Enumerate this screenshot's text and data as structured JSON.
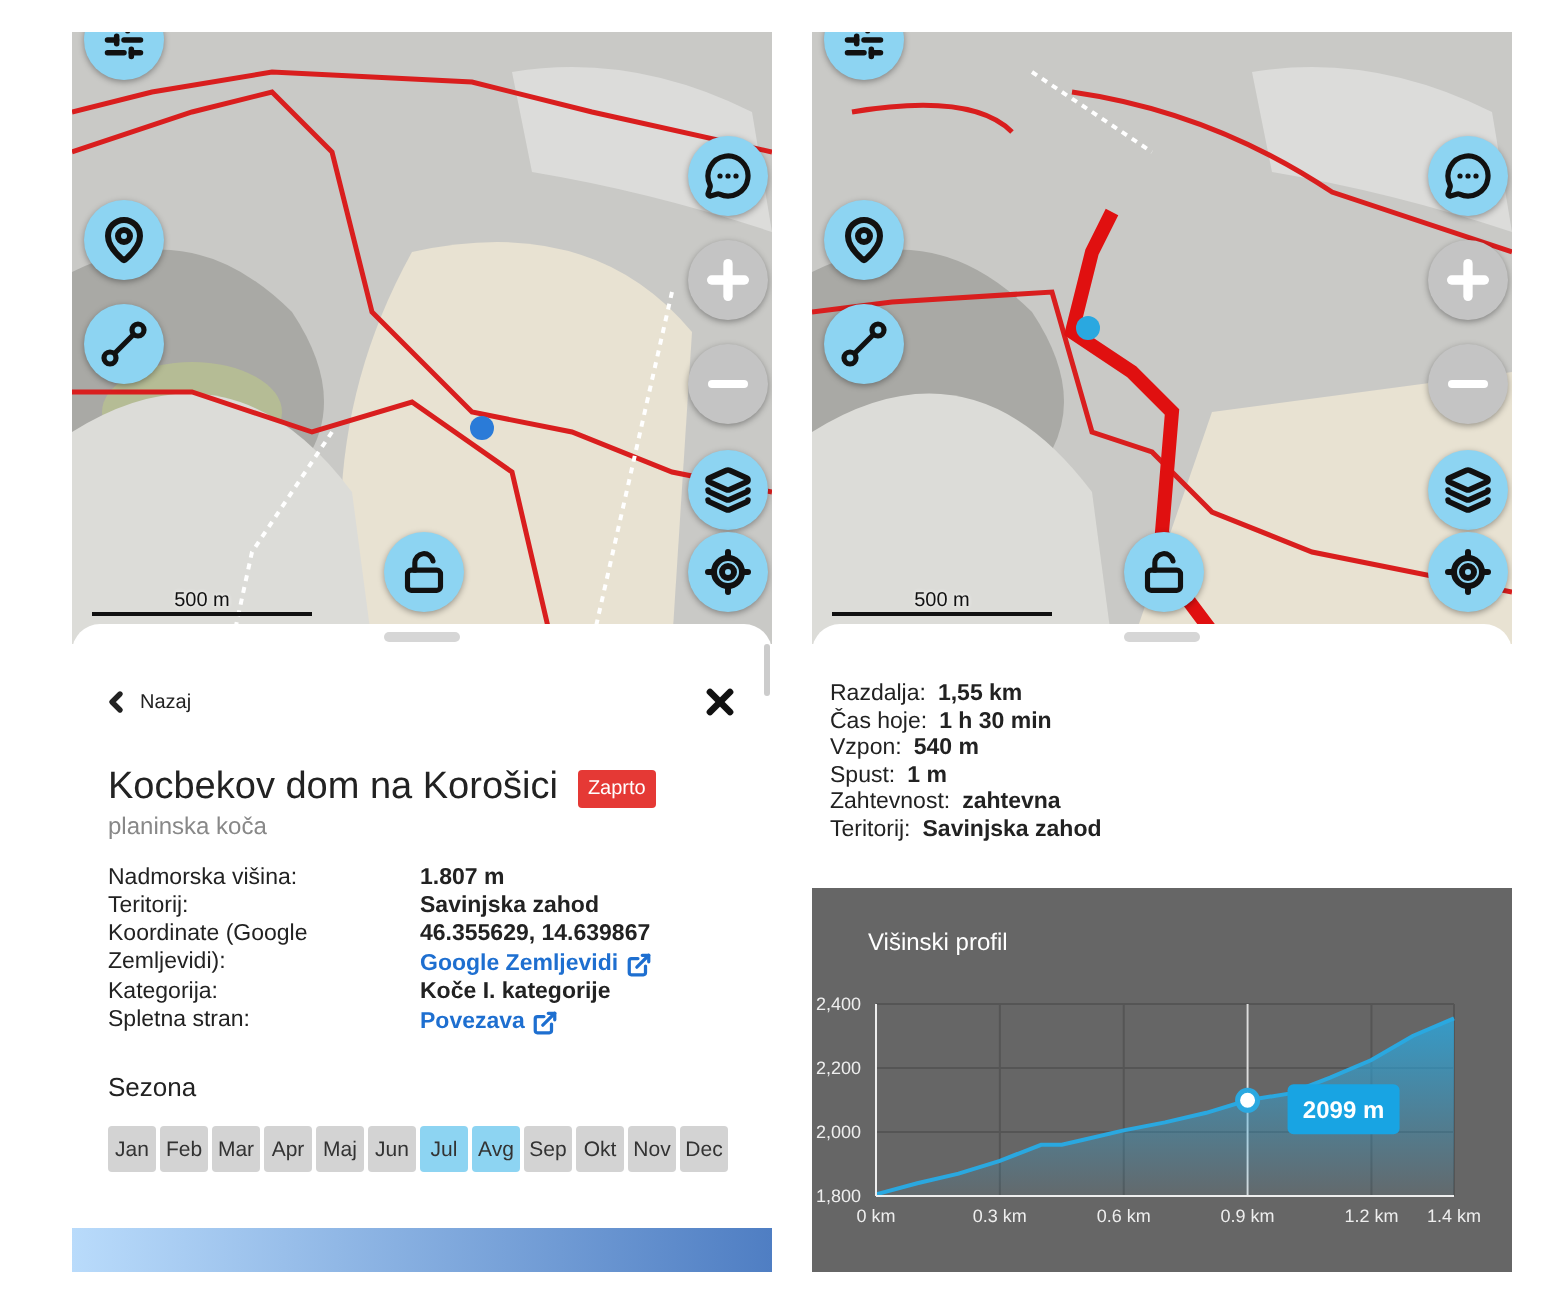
{
  "poi_screen": {
    "map": {
      "scale": "500 m"
    },
    "back": "Nazaj",
    "title": "Kocbekov dom na Korošici",
    "status_badge": "Zaprto",
    "subtitle": "planinska koča",
    "details": [
      {
        "label": "Nadmorska višina:",
        "value": "1.807 m"
      },
      {
        "label": "Teritorij:",
        "value": "Savinjska zahod"
      },
      {
        "label": "Koordinate (Google Zemljevidi):",
        "value": "46.355629, 14.639867",
        "link": "Google Zemljevidi"
      },
      {
        "label": "Kategorija:",
        "value": "Koče I. kategorije"
      },
      {
        "label": "Spletna stran:",
        "link": "Povezava"
      }
    ],
    "season": {
      "title": "Sezona",
      "months": [
        {
          "label": "Jan",
          "selected": false
        },
        {
          "label": "Feb",
          "selected": false
        },
        {
          "label": "Mar",
          "selected": false
        },
        {
          "label": "Apr",
          "selected": false
        },
        {
          "label": "Maj",
          "selected": false
        },
        {
          "label": "Jun",
          "selected": false
        },
        {
          "label": "Jul",
          "selected": true
        },
        {
          "label": "Avg",
          "selected": true
        },
        {
          "label": "Sep",
          "selected": false
        },
        {
          "label": "Okt",
          "selected": false
        },
        {
          "label": "Nov",
          "selected": false
        },
        {
          "label": "Dec",
          "selected": false
        }
      ]
    }
  },
  "route_screen": {
    "map": {
      "scale": "500 m"
    },
    "stats": [
      {
        "label": "Razdalja:",
        "value": "1,55 km"
      },
      {
        "label": "Čas hoje:",
        "value": "1 h 30 min"
      },
      {
        "label": "Vzpon:",
        "value": "540 m"
      },
      {
        "label": "Spust:",
        "value": "1 m"
      },
      {
        "label": "Zahtevnost:",
        "value": "zahtevna"
      },
      {
        "label": "Teritorij:",
        "value": "Savinjska zahod"
      }
    ],
    "profile": {
      "chart_data": {
        "type": "area",
        "title": "Višinski profil",
        "x": [
          0,
          0.1,
          0.2,
          0.3,
          0.4,
          0.45,
          0.5,
          0.6,
          0.7,
          0.8,
          0.9,
          1.0,
          1.1,
          1.2,
          1.3,
          1.4
        ],
        "series": [
          {
            "color": "#2aa8e0",
            "values": [
              1805,
              1840,
              1870,
              1910,
              1960,
              1960,
              1975,
              2005,
              2030,
              2060,
              2099,
              2120,
              2170,
              2225,
              2300,
              2355
            ]
          }
        ],
        "xlim": [
          0,
          1.4
        ],
        "ylim": [
          1800,
          2400
        ],
        "xticks": [
          {
            "value": 0,
            "label": "0 km"
          },
          {
            "value": 0.3,
            "label": "0.3 km"
          },
          {
            "value": 0.6,
            "label": "0.6 km"
          },
          {
            "value": 0.9,
            "label": "0.9 km"
          },
          {
            "value": 1.2,
            "label": "1.2 km"
          },
          {
            "value": 1.4,
            "label": "1.4 km"
          }
        ],
        "yticks": [
          {
            "value": 1800,
            "label": "1,800"
          },
          {
            "value": 2000,
            "label": "2,000"
          },
          {
            "value": 2200,
            "label": "2,200"
          },
          {
            "value": 2400,
            "label": "2,400"
          }
        ],
        "grid": true,
        "ref_lines": [
          {
            "axis": "x",
            "value": 0.9
          }
        ],
        "annotations": [
          {
            "x": 0.9,
            "y": 2099,
            "text": "2099 m"
          }
        ]
      }
    }
  }
}
